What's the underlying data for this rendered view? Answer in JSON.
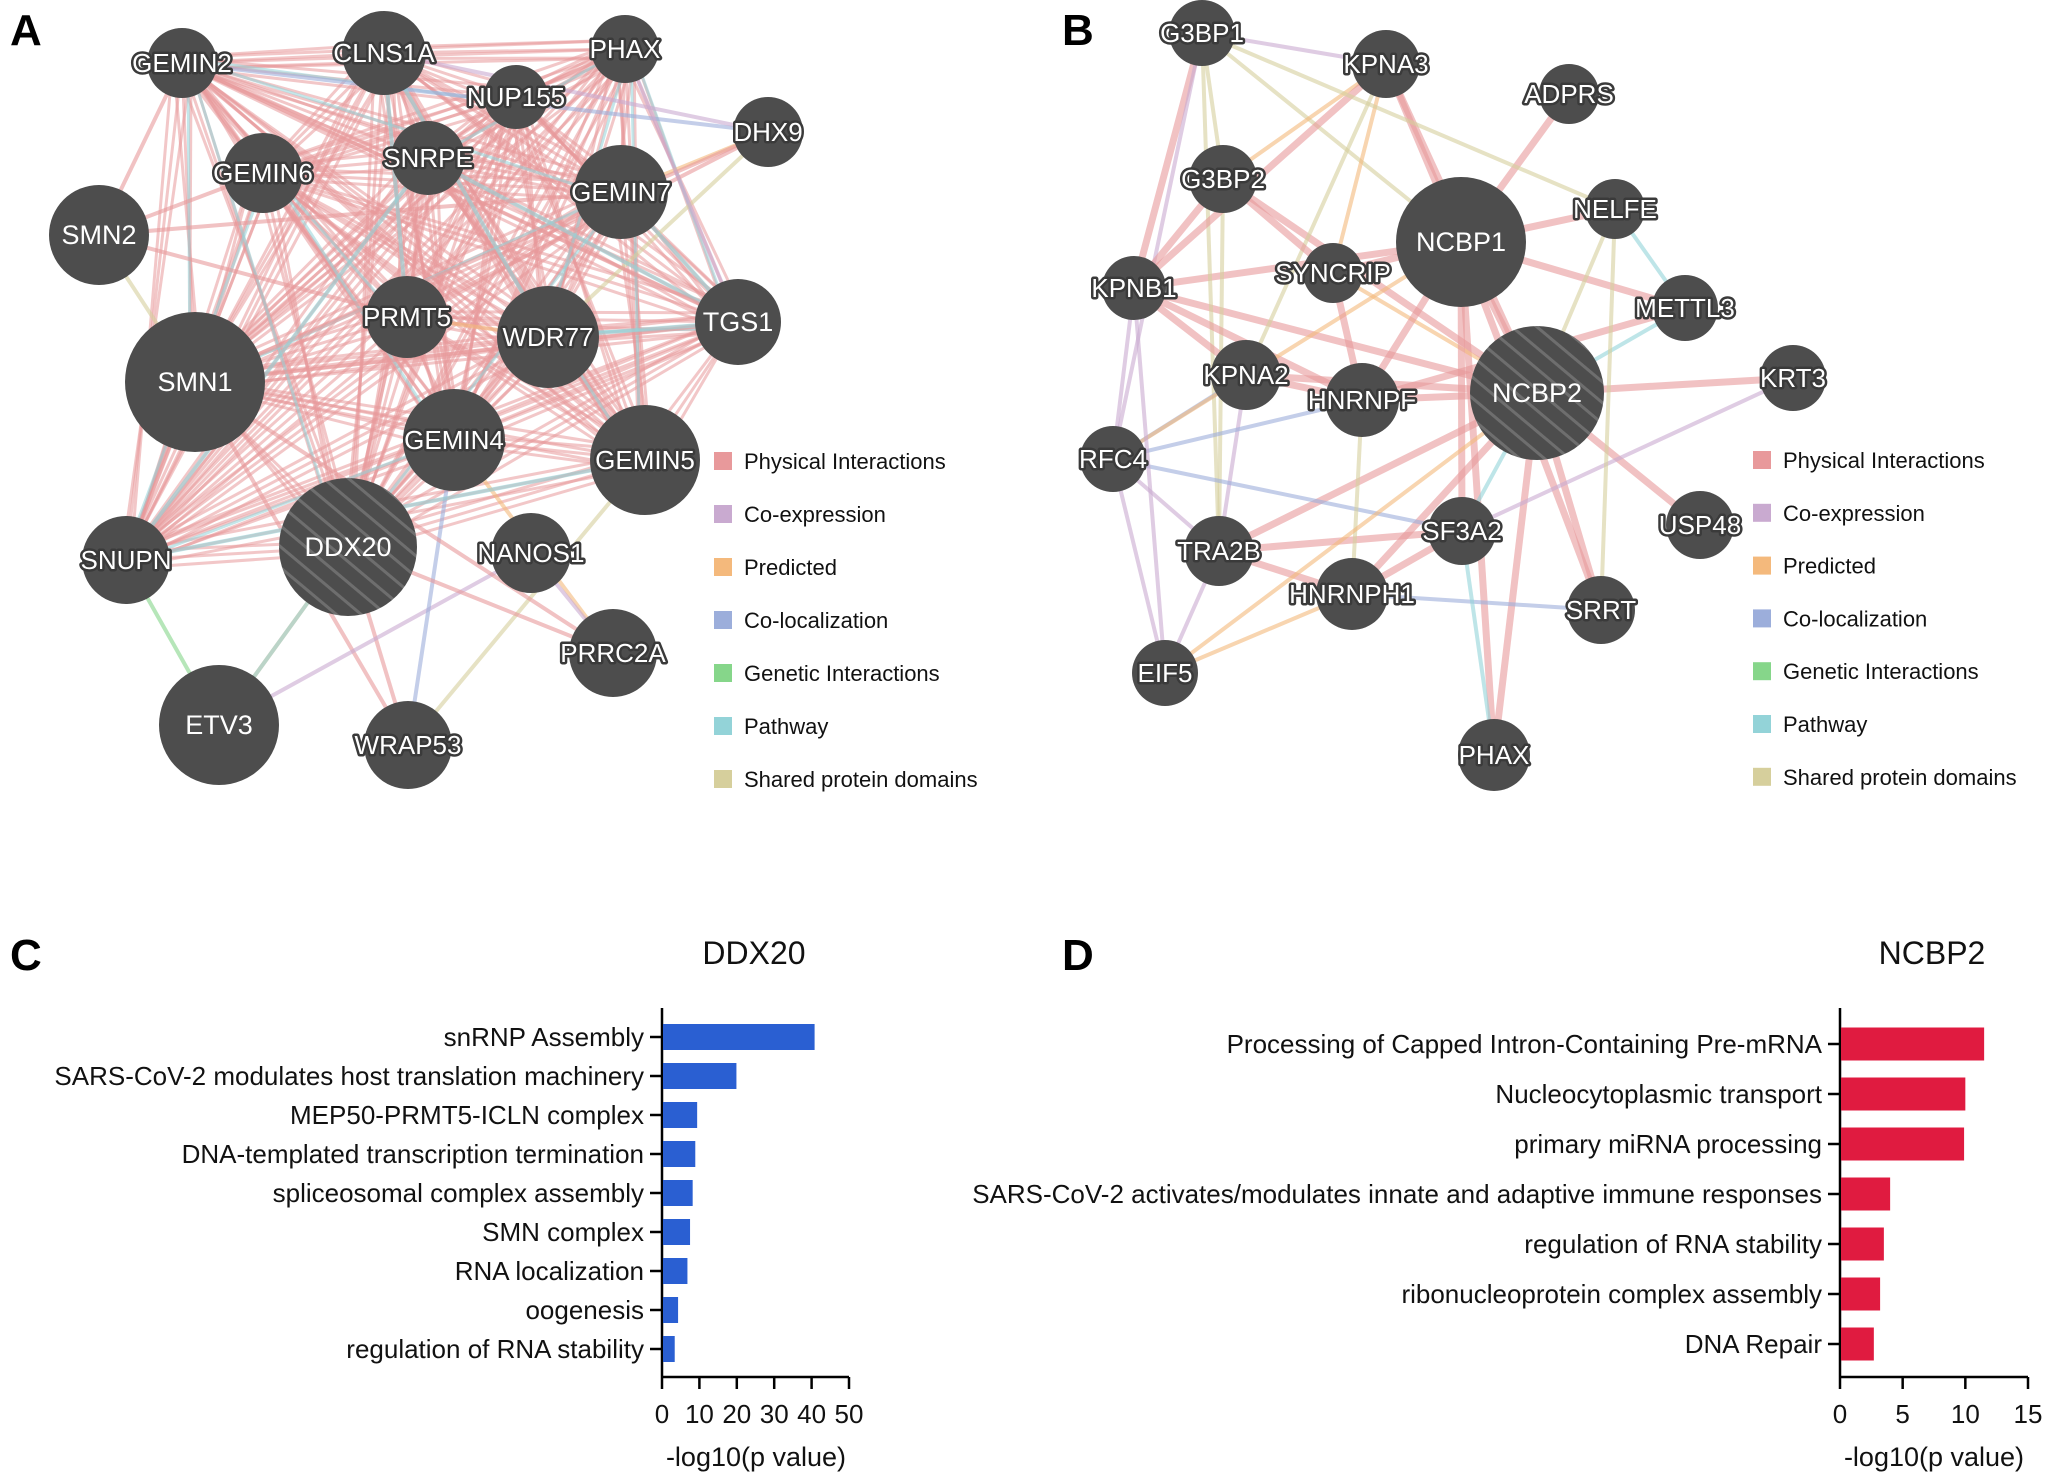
{
  "figure": {
    "panels": {
      "A": "A",
      "B": "B",
      "C": "C",
      "D": "D"
    }
  },
  "legend": {
    "items": [
      {
        "key": "physical",
        "label": "Physical Interactions",
        "color": "#e8999b"
      },
      {
        "key": "coexpression",
        "label": "Co-expression",
        "color": "#c9aad0"
      },
      {
        "key": "predicted",
        "label": "Predicted",
        "color": "#f4b97c"
      },
      {
        "key": "colocalization",
        "label": "Co-localization",
        "color": "#9caedb"
      },
      {
        "key": "genetic",
        "label": "Genetic Interactions",
        "color": "#86d68a"
      },
      {
        "key": "pathway",
        "label": "Pathway",
        "color": "#93d3d8"
      },
      {
        "key": "domains",
        "label": "Shared protein domains",
        "color": "#d6cf9c"
      }
    ]
  },
  "networkA": {
    "query": "DDX20",
    "nodes": [
      "GEMIN2",
      "CLNS1A",
      "PHAX",
      "NUP155",
      "DHX9",
      "GEMIN6",
      "SNRPE",
      "GEMIN7",
      "SMN2",
      "TGS1",
      "PRMT5",
      "WDR77",
      "SMN1",
      "GEMIN4",
      "GEMIN5",
      "SNUPN",
      "DDX20",
      "NANOS1",
      "PRRC2A",
      "ETV3",
      "WRAP53"
    ],
    "outlined_labels": [
      "GEMIN2",
      "CLNS1A",
      "PHAX",
      "NUP155",
      "DHX9",
      "GEMIN6",
      "SNRPE",
      "GEMIN7",
      "PRMT5",
      "WDR77",
      "GEMIN4",
      "GEMIN5",
      "SNUPN",
      "NANOS1",
      "PRRC2A",
      "WRAP53"
    ],
    "edges": [
      [
        "DDX20",
        "ETV3",
        "predicted"
      ],
      [
        "DDX20",
        "ETV3",
        "pathway"
      ],
      [
        "SNUPN",
        "ETV3",
        "genetic"
      ],
      [
        "DDX20",
        "WRAP53",
        "physical"
      ],
      [
        "SMN1",
        "WRAP53",
        "physical"
      ],
      [
        "ETV3",
        "NANOS1",
        "coexpression"
      ],
      [
        "GEMIN4",
        "WRAP53",
        "colocalization"
      ],
      [
        "GEMIN5",
        "WRAP53",
        "domains"
      ],
      [
        "DDX20",
        "PRRC2A",
        "physical"
      ],
      [
        "SMN1",
        "PRRC2A",
        "physical"
      ],
      [
        "GEMIN4",
        "PRRC2A",
        "predicted"
      ],
      [
        "NANOS1",
        "PRRC2A",
        "coexpression"
      ],
      [
        "DHX9",
        "GEMIN7",
        "predicted"
      ],
      [
        "DHX9",
        "WDR77",
        "domains"
      ],
      [
        "DHX9",
        "PRMT5",
        "physical"
      ],
      [
        "DHX9",
        "GEMIN2",
        "colocalization"
      ],
      [
        "DHX9",
        "CLNS1A",
        "coexpression"
      ],
      [
        "DHX9",
        "SMN1",
        "physical"
      ],
      [
        "TGS1",
        "GEMIN7",
        "pathway"
      ],
      [
        "TGS1",
        "SNRPE",
        "pathway"
      ],
      [
        "TGS1",
        "PHAX",
        "coexpression"
      ],
      [
        "TGS1",
        "SMN1",
        "physical"
      ],
      [
        "TGS1",
        "GEMIN2",
        "physical"
      ],
      [
        "TGS1",
        "WDR77",
        "pathway"
      ],
      [
        "SMN2",
        "SMN1",
        "domains"
      ],
      [
        "SMN2",
        "GEMIN2",
        "physical"
      ],
      [
        "SMN2",
        "GEMIN6",
        "physical"
      ],
      [
        "SMN2",
        "PRMT5",
        "physical"
      ],
      [
        "SMN2",
        "GEMIN7",
        "physical"
      ],
      [
        "SNUPN",
        "SNRPE",
        "pathway"
      ],
      [
        "SNUPN",
        "GEMIN5",
        "pathway"
      ],
      [
        "SNUPN",
        "SMN1",
        "physical"
      ],
      [
        "NUP155",
        "PHAX",
        "physical"
      ],
      [
        "PRMT5",
        "WDR77",
        "predicted"
      ],
      [
        "PRMT5",
        "CLNS1A",
        "pathway"
      ],
      [
        "WDR77",
        "CLNS1A",
        "pathway"
      ]
    ],
    "dense_physical_core": [
      "GEMIN2",
      "CLNS1A",
      "PHAX",
      "NUP155",
      "GEMIN6",
      "SNRPE",
      "GEMIN7",
      "PRMT5",
      "WDR77",
      "SMN1",
      "GEMIN4",
      "GEMIN5",
      "DDX20",
      "SNUPN",
      "TGS1"
    ]
  },
  "networkB": {
    "query": "NCBP2",
    "nodes": [
      "G3BP1",
      "KPNA3",
      "ADPRS",
      "G3BP2",
      "NCBP1",
      "NELFE",
      "SYNCRIP",
      "KPNB1",
      "METTL3",
      "KPNA2",
      "HNRNPF",
      "NCBP2",
      "KRT3",
      "RFC4",
      "USP48",
      "SF3A2",
      "TRA2B",
      "HNRNPH1",
      "SRRT",
      "EIF5",
      "PHAX"
    ],
    "edges": [
      [
        "NCBP2",
        "KRT3",
        "physical"
      ],
      [
        "NCBP2",
        "USP48",
        "physical"
      ],
      [
        "NCBP2",
        "PHAX",
        "physical"
      ],
      [
        "NCBP1",
        "PHAX",
        "physical"
      ],
      [
        "NCBP1",
        "NCBP2",
        "physical"
      ],
      [
        "NCBP1",
        "ADPRS",
        "physical"
      ],
      [
        "NCBP1",
        "SRRT",
        "physical"
      ],
      [
        "NCBP2",
        "SRRT",
        "physical"
      ],
      [
        "NCBP1",
        "METTL3",
        "physical"
      ],
      [
        "NCBP2",
        "METTL3",
        "pathway"
      ],
      [
        "NCBP1",
        "NELFE",
        "physical"
      ],
      [
        "NCBP2",
        "NELFE",
        "domains"
      ],
      [
        "NCBP2",
        "HNRNPF",
        "physical"
      ],
      [
        "NCBP2",
        "KPNA2",
        "physical"
      ],
      [
        "NCBP2",
        "KPNB1",
        "physical"
      ],
      [
        "NCBP2",
        "SYNCRIP",
        "predicted"
      ],
      [
        "NCBP2",
        "TRA2B",
        "physical"
      ],
      [
        "NCBP2",
        "HNRNPH1",
        "physical"
      ],
      [
        "NCBP2",
        "SF3A2",
        "pathway"
      ],
      [
        "NCBP2",
        "G3BP2",
        "physical"
      ],
      [
        "NCBP2",
        "KPNA3",
        "physical"
      ],
      [
        "NCBP1",
        "KPNA3",
        "physical"
      ],
      [
        "NCBP1",
        "G3BP1",
        "domains"
      ],
      [
        "NCBP1",
        "KPNB1",
        "physical"
      ],
      [
        "NCBP1",
        "HNRNPF",
        "physical"
      ],
      [
        "NCBP1",
        "SF3A2",
        "physical"
      ],
      [
        "NCBP1",
        "SYNCRIP",
        "physical"
      ],
      [
        "G3BP1",
        "G3BP2",
        "domains"
      ],
      [
        "G3BP1",
        "KPNB1",
        "physical"
      ],
      [
        "G3BP1",
        "KPNA3",
        "coexpression"
      ],
      [
        "G3BP1",
        "RFC4",
        "coexpression"
      ],
      [
        "G3BP1",
        "TRA2B",
        "domains"
      ],
      [
        "G3BP2",
        "KPNB1",
        "physical"
      ],
      [
        "G3BP2",
        "KPNA3",
        "predicted"
      ],
      [
        "G3BP2",
        "TRA2B",
        "domains"
      ],
      [
        "KPNB1",
        "KPNA2",
        "physical"
      ],
      [
        "KPNB1",
        "KPNA3",
        "physical"
      ],
      [
        "KPNB1",
        "RFC4",
        "coexpression"
      ],
      [
        "KPNB1",
        "HNRNPF",
        "physical"
      ],
      [
        "KPNA2",
        "KPNA3",
        "domains"
      ],
      [
        "KPNA2",
        "RFC4",
        "colocalization"
      ],
      [
        "KPNA2",
        "HNRNPF",
        "physical"
      ],
      [
        "KPNA2",
        "TRA2B",
        "coexpression"
      ],
      [
        "RFC4",
        "EIF5",
        "coexpression"
      ],
      [
        "RFC4",
        "TRA2B",
        "coexpression"
      ],
      [
        "RFC4",
        "HNRNPF",
        "colocalization"
      ],
      [
        "RFC4",
        "SF3A2",
        "colocalization"
      ],
      [
        "RFC4",
        "NCBP1",
        "predicted"
      ],
      [
        "TRA2B",
        "HNRNPH1",
        "physical"
      ],
      [
        "TRA2B",
        "EIF5",
        "coexpression"
      ],
      [
        "TRA2B",
        "SF3A2",
        "physical"
      ],
      [
        "HNRNPF",
        "HNRNPH1",
        "domains"
      ],
      [
        "HNRNPF",
        "SYNCRIP",
        "physical"
      ],
      [
        "HNRNPH1",
        "SRRT",
        "colocalization"
      ],
      [
        "HNRNPH1",
        "EIF5",
        "predicted"
      ],
      [
        "HNRNPH1",
        "SF3A2",
        "physical"
      ],
      [
        "SF3A2",
        "PHAX",
        "pathway"
      ],
      [
        "SYNCRIP",
        "KPNA3",
        "predicted"
      ],
      [
        "SYNCRIP",
        "G3BP2",
        "physical"
      ],
      [
        "METTL3",
        "HNRNPF",
        "physical"
      ],
      [
        "METTL3",
        "NELFE",
        "pathway"
      ],
      [
        "KRT3",
        "SF3A2",
        "coexpression"
      ],
      [
        "SRRT",
        "NELFE",
        "domains"
      ],
      [
        "EIF5",
        "KPNB1",
        "coexpression"
      ],
      [
        "EIF5",
        "NCBP2",
        "predicted"
      ],
      [
        "G3BP1",
        "NELFE",
        "domains"
      ]
    ]
  },
  "chart_data": [
    {
      "type": "bar",
      "orientation": "horizontal",
      "title": "DDX20",
      "categories": [
        "snRNP Assembly",
        "SARS-CoV-2 modulates host translation machinery",
        "MEP50-PRMT5-ICLN complex",
        "DNA-templated transcription termination",
        "spliceosomal complex assembly",
        "SMN complex",
        "RNA localization",
        "oogenesis",
        "regulation of RNA stability"
      ],
      "values": [
        40.8,
        19.9,
        9.4,
        8.9,
        8.2,
        7.5,
        6.8,
        4.3,
        3.4
      ],
      "xlabel": "-log10(p value)",
      "ylabel": "",
      "xlim": [
        0,
        50
      ],
      "xticks": [
        "0",
        "10",
        "20",
        "30",
        "40",
        "50"
      ],
      "xtick_values": [
        0,
        10,
        20,
        30,
        40,
        50
      ],
      "color": "#2a5fd2",
      "grid": false
    },
    {
      "type": "bar",
      "orientation": "horizontal",
      "title": "NCBP2",
      "categories": [
        "Processing of Capped Intron-Containing Pre-mRNA",
        "Nucleocytoplasmic transport",
        "primary miRNA processing",
        "SARS-CoV-2 activates/modulates innate and adaptive immune responses",
        "regulation of RNA stability",
        "ribonucleoprotein complex assembly",
        "DNA Repair"
      ],
      "values": [
        11.5,
        10.0,
        9.9,
        4.0,
        3.5,
        3.2,
        2.7
      ],
      "xlabel": "-log10(p value)",
      "ylabel": "",
      "xlim": [
        0,
        15
      ],
      "xticks": [
        "0",
        "5",
        "10",
        "15"
      ],
      "xtick_values": [
        0,
        5,
        10,
        15
      ],
      "color": "#e01b40",
      "grid": false
    }
  ]
}
